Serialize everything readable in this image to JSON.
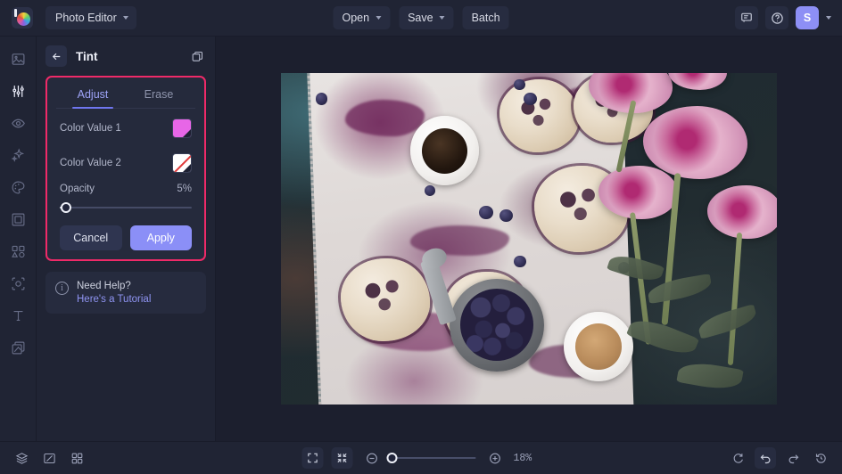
{
  "topbar": {
    "logo_icon": "colorwheel-logo-icon",
    "app_menu_label": "Photo Editor",
    "center_buttons": [
      {
        "label": "Open",
        "has_caret": true,
        "name": "open-button"
      },
      {
        "label": "Save",
        "has_caret": true,
        "name": "save-button"
      },
      {
        "label": "Batch",
        "has_caret": false,
        "name": "batch-button"
      }
    ],
    "feedback_icon": "chat-bubble-icon",
    "help_icon": "question-circle-icon",
    "avatar_initial": "S"
  },
  "rail": {
    "items": [
      {
        "name": "sidebar-item-image",
        "icon": "picture-icon",
        "active": false
      },
      {
        "name": "sidebar-item-adjust",
        "icon": "sliders-icon",
        "active": true
      },
      {
        "name": "sidebar-item-retouch",
        "icon": "eye-icon",
        "active": false
      },
      {
        "name": "sidebar-item-effects",
        "icon": "sparkles-icon",
        "active": false
      },
      {
        "name": "sidebar-item-color",
        "icon": "palette-icon",
        "active": false
      },
      {
        "name": "sidebar-item-frames",
        "icon": "frame-icon",
        "active": false
      },
      {
        "name": "sidebar-item-shapes",
        "icon": "shapes-icon",
        "active": false
      },
      {
        "name": "sidebar-item-cutout",
        "icon": "cutout-icon",
        "active": false
      },
      {
        "name": "sidebar-item-text",
        "icon": "text-t-icon",
        "active": false
      },
      {
        "name": "sidebar-item-layers",
        "icon": "layers-copy-icon",
        "active": false
      }
    ]
  },
  "panel": {
    "back_icon": "arrow-left-icon",
    "title": "Tint",
    "duplicate_icon": "duplicate-layers-icon",
    "tabs": [
      {
        "label": "Adjust",
        "active": true
      },
      {
        "label": "Erase",
        "active": false
      }
    ],
    "controls": [
      {
        "label": "Color Value 1",
        "swatch": "#e766e7",
        "kind": "color"
      },
      {
        "label": "Color Value 2",
        "swatch": "#ffffff",
        "kind": "none"
      }
    ],
    "opacity": {
      "label": "Opacity",
      "value_text": "5%",
      "value": 5,
      "min": 0,
      "max": 100
    },
    "cancel_label": "Cancel",
    "apply_label": "Apply",
    "help": {
      "icon": "info-circle-icon",
      "glyph": "i",
      "title": "Need Help?",
      "link": "Here's a Tutorial"
    },
    "highlight_color": "#ef2a68"
  },
  "canvas": {
    "photo_alt": "Blueberry crumble scones on parchment with black coffee, a bowl of blueberries, a latte and pink peonies on a dark slate background"
  },
  "bottombar": {
    "left_icons": [
      {
        "name": "layers-stack-icon",
        "icon": "layers-stack-icon",
        "boxed": false
      },
      {
        "name": "compare-icon",
        "icon": "compare-split-icon",
        "boxed": false
      },
      {
        "name": "grid-view-icon",
        "icon": "grid-four-icon",
        "boxed": false
      }
    ],
    "fit_icons": [
      {
        "name": "fit-to-screen-button",
        "icon": "expand-corners-icon"
      },
      {
        "name": "actual-size-button",
        "icon": "collapse-arrows-icon"
      }
    ],
    "zoom_out_icon": "minus-circle-icon",
    "zoom_in_icon": "plus-circle-icon",
    "zoom_value": "18%",
    "zoom_percent": 18,
    "right_icons": [
      {
        "name": "reset-button",
        "icon": "refresh-cycle-icon",
        "boxed": false
      },
      {
        "name": "undo-button",
        "icon": "undo-arrow-icon",
        "boxed": true
      },
      {
        "name": "redo-button",
        "icon": "redo-arrow-icon",
        "boxed": false
      },
      {
        "name": "history-button",
        "icon": "history-clock-icon",
        "boxed": false
      }
    ]
  }
}
